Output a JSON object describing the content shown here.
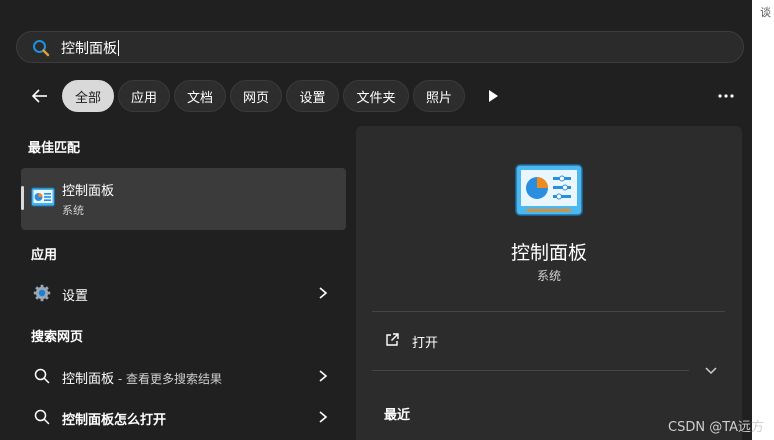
{
  "search": {
    "query": "控制面板"
  },
  "filters": {
    "back_icon": "back-arrow-icon",
    "tabs": [
      {
        "label": "全部",
        "active": true
      },
      {
        "label": "应用"
      },
      {
        "label": "文档"
      },
      {
        "label": "网页"
      },
      {
        "label": "设置"
      },
      {
        "label": "文件夹"
      },
      {
        "label": "照片"
      }
    ],
    "play_icon": "play-icon",
    "more_icon": "more-horizontal-icon"
  },
  "best_match": {
    "section_title": "最佳匹配",
    "title": "控制面板",
    "subtitle": "系统",
    "icon": "control-panel-icon"
  },
  "apps": {
    "section_title": "应用",
    "items": [
      {
        "label": "设置",
        "icon": "settings-gear-icon"
      }
    ]
  },
  "web": {
    "section_title": "搜索网页",
    "items": [
      {
        "label": "控制面板",
        "suffix": " - 查看更多搜索结果",
        "icon": "search-icon"
      },
      {
        "label": "控制面板怎么打开",
        "icon": "search-icon"
      }
    ]
  },
  "preview": {
    "title": "控制面板",
    "subtitle": "系统",
    "actions": [
      {
        "label": "打开",
        "icon": "open-external-icon"
      }
    ],
    "recent_title": "最近"
  },
  "watermark": "CSDN @TA远方",
  "edge_text": "谈",
  "colors": {
    "background": "#202020",
    "panel": "#2c2c2c",
    "selected": "#3b3b3b",
    "accent": "#0a84d6"
  }
}
